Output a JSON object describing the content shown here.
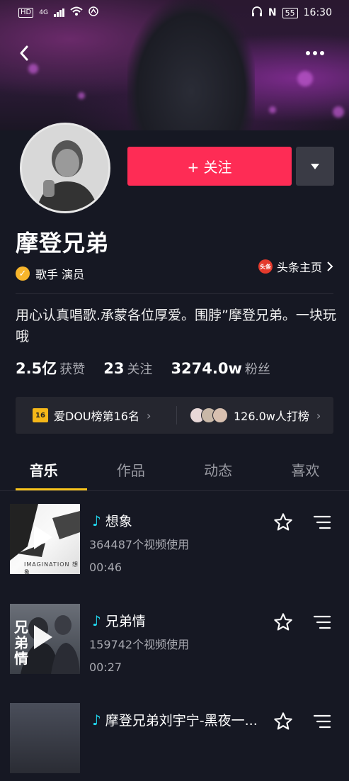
{
  "status_bar": {
    "left_labels": [
      "HD",
      "4G"
    ],
    "time": "16:30",
    "battery": "55",
    "nfc": "N"
  },
  "profile": {
    "follow_label": "+ 关注",
    "name": "摩登兄弟",
    "verify_icon": "check-icon",
    "verify_text": "歌手 演员",
    "toutiao_icon_text": "头条",
    "toutiao_label": "头条主页",
    "bio": "用心认真唱歌.承蒙各位厚爱。围脖”摩登兄弟。一块玩哦"
  },
  "stats": [
    {
      "num": "2.5亿",
      "label": "获赞"
    },
    {
      "num": "23",
      "label": "关注"
    },
    {
      "num": "3274.0w",
      "label": "粉丝"
    }
  ],
  "rank": {
    "badge": "16",
    "left_label": "爱DOU榜第16名",
    "right_label": "126.0w人打榜",
    "chevron": "›"
  },
  "tabs": [
    {
      "label": "音乐",
      "active": true
    },
    {
      "label": "作品",
      "active": false
    },
    {
      "label": "动态",
      "active": false
    },
    {
      "label": "喜欢",
      "active": false
    }
  ],
  "songs": [
    {
      "title": "想象",
      "uses": "364487个视频使用",
      "duration": "00:46",
      "cover_text": "IMAGINATION 想象"
    },
    {
      "title": "兄弟情",
      "uses": "159742个视频使用",
      "duration": "00:27",
      "cover_text": "兄弟情"
    },
    {
      "title": "摩登兄弟刘宇宁-黑夜一...",
      "uses": "",
      "duration": "",
      "cover_text": ""
    }
  ],
  "colors": {
    "accent": "#fe2c55",
    "tab_indicator": "#f7c31c",
    "note": "#20d5ec",
    "background": "#161823"
  }
}
